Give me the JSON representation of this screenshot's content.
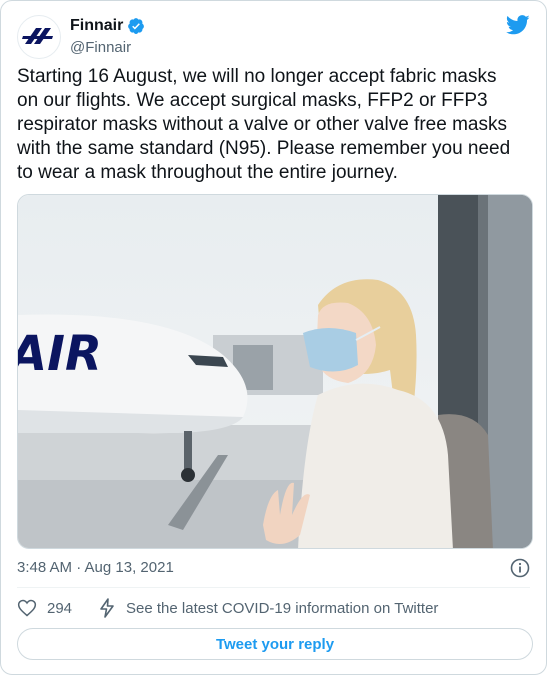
{
  "author": {
    "display_name": "Finnair",
    "handle": "@Finnair",
    "verified": true,
    "avatar_icon": "finnair-logo-icon"
  },
  "tweet": {
    "text": "Starting 16 August, we will no longer accept fabric masks\non our flights. We accept surgical masks, FFP2 or FFP3\nrespirator masks without a valve or other valve free masks\nwith the same standard (N95). Please remember you need\nto wear a mask throughout the entire journey.",
    "timestamp": "3:48 AM · Aug 13, 2021",
    "media_description_icon": "photo-child-mask-airplane"
  },
  "actions": {
    "like_count": "294",
    "covid_link": "See the latest COVID-19 information on Twitter",
    "reply_label": "Tweet your reply"
  },
  "colors": {
    "accent": "#1d9bf0",
    "brand_blue": "#0b1560",
    "secondary_text": "#536471",
    "border": "#cfd9de"
  }
}
